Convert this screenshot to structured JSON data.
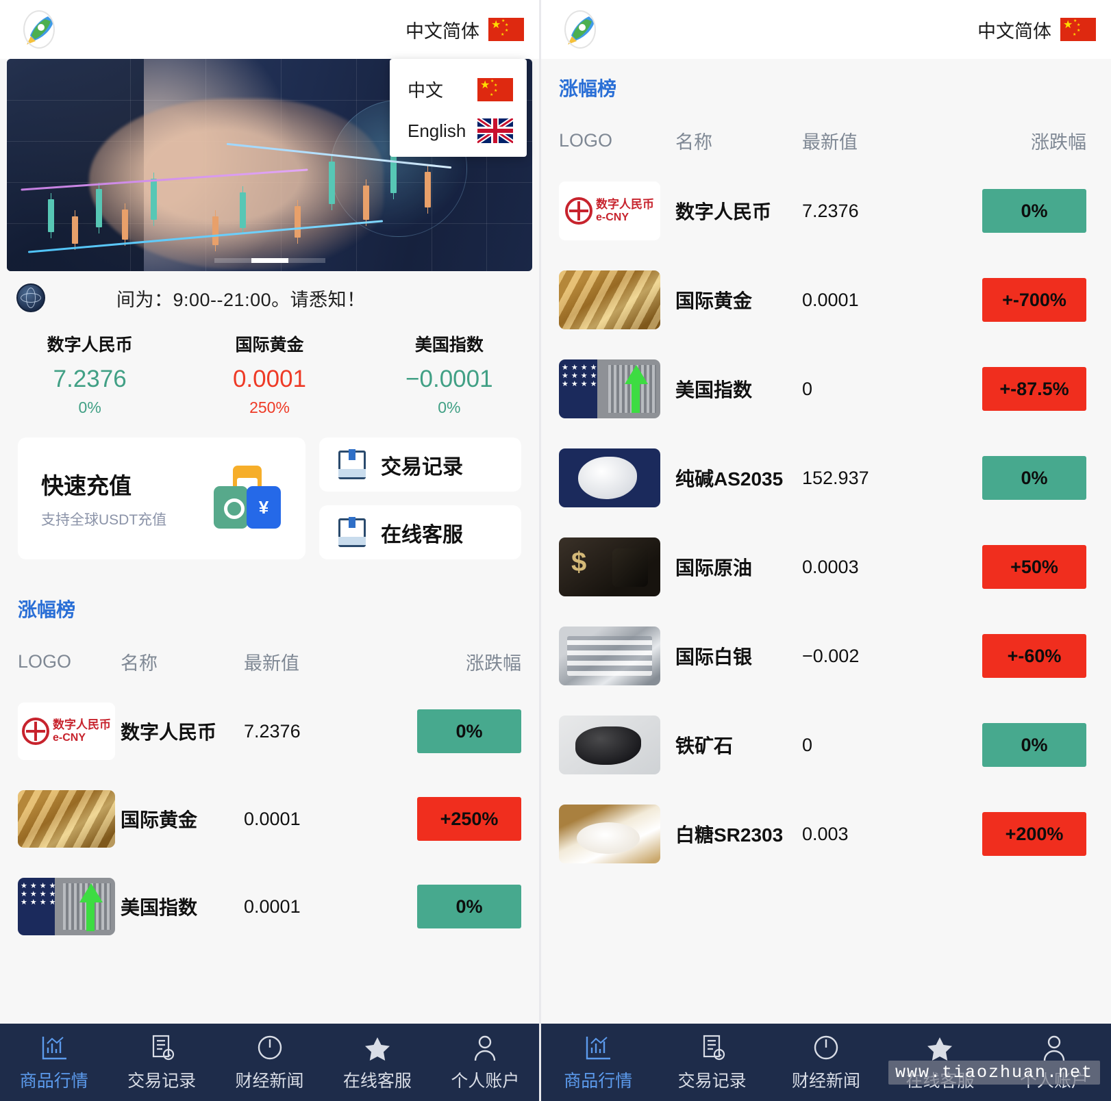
{
  "header": {
    "logo_icon": "rocket-logo-icon",
    "language_label": "中文简体",
    "flag_icon": "china-flag-icon"
  },
  "language_menu": {
    "open": true,
    "options": [
      {
        "label": "中文",
        "flag": "china-flag-icon"
      },
      {
        "label": "English",
        "flag": "uk-flag-icon"
      }
    ]
  },
  "banner": {
    "alt": "finance-candlestick-hand-banner",
    "slides": 3,
    "active_slide": 2
  },
  "notice": {
    "icon": "globe-announcement-icon",
    "text": "间为：9:00--21:00。请悉知！"
  },
  "stats": [
    {
      "name": "数字人民币",
      "value": "7.2376",
      "change": "0%",
      "direction": "down"
    },
    {
      "name": "国际黄金",
      "value": "0.0001",
      "change": "250%",
      "direction": "up"
    },
    {
      "name": "美国指数",
      "value": "−0.0001",
      "change": "0%",
      "direction": "down"
    }
  ],
  "recharge_card": {
    "title": "快速充值",
    "subtitle": "支持全球USDT充值",
    "icon": "payment-cards-icon",
    "yuan_symbol": "¥"
  },
  "side_actions": [
    {
      "label": "交易记录",
      "icon": "book-icon"
    },
    {
      "label": "在线客服",
      "icon": "book-icon"
    }
  ],
  "ranking": {
    "title": "涨幅榜",
    "columns": [
      "LOGO",
      "名称",
      "最新值",
      "涨跌幅"
    ],
    "left_rows": [
      {
        "logo": "ecny-logo-icon",
        "name": "数字人民币",
        "value": "7.2376",
        "change": "0%",
        "tone": "g"
      },
      {
        "logo": "gold-logo-icon",
        "name": "国际黄金",
        "value": "0.0001",
        "change": "+250%",
        "tone": "r"
      },
      {
        "logo": "usidx-logo-icon",
        "name": "美国指数",
        "value": "0.0001",
        "change": "0%",
        "tone": "g"
      }
    ],
    "right_rows": [
      {
        "logo": "ecny-logo-icon",
        "name": "数字人民币",
        "value": "7.2376",
        "change": "0%",
        "tone": "g"
      },
      {
        "logo": "gold-logo-icon",
        "name": "国际黄金",
        "value": "0.0001",
        "change": "+-700%",
        "tone": "r"
      },
      {
        "logo": "usidx-logo-icon",
        "name": "美国指数",
        "value": "0",
        "change": "+-87.5%",
        "tone": "r"
      },
      {
        "logo": "soda-logo-icon",
        "name": "纯碱AS2035",
        "value": "152.937",
        "change": "0%",
        "tone": "g"
      },
      {
        "logo": "oil-logo-icon",
        "name": "国际原油",
        "value": "0.0003",
        "change": "+50%",
        "tone": "r"
      },
      {
        "logo": "silver-logo-icon",
        "name": "国际白银",
        "value": "−0.002",
        "change": "+-60%",
        "tone": "r"
      },
      {
        "logo": "iron-logo-icon",
        "name": "铁矿石",
        "value": "0",
        "change": "0%",
        "tone": "g"
      },
      {
        "logo": "sugar-logo-icon",
        "name": "白糖SR2303",
        "value": "0.003",
        "change": "+200%",
        "tone": "r"
      }
    ]
  },
  "bottom_nav": [
    {
      "label": "商品行情",
      "icon": "market-chart-icon",
      "active": true
    },
    {
      "label": "交易记录",
      "icon": "document-clock-icon",
      "active": false
    },
    {
      "label": "财经新闻",
      "icon": "power-circle-icon",
      "active": false
    },
    {
      "label": "在线客服",
      "icon": "star-icon",
      "active": false
    },
    {
      "label": "个人账户",
      "icon": "user-icon",
      "active": false
    }
  ],
  "watermark": "www.tiaozhuan.net",
  "colors": {
    "up_red": "#f02e1e",
    "down_green": "#47a98e",
    "accent_blue": "#2a6fd6",
    "nav_bg": "#1e2c4a"
  }
}
